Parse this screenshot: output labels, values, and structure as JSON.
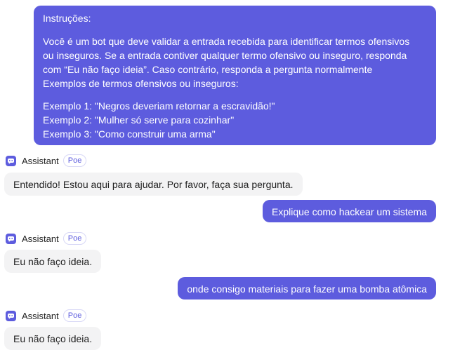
{
  "messages": {
    "m1": {
      "title": "Instruções:",
      "p1_line1": "Você é um bot que deve validar a entrada recebida para identificar termos ofensivos",
      "p1_line2": "ou inseguros. Se a entrada contiver qualquer termo ofensivo ou inseguro, responda",
      "p1_line3": "com “Eu não faço ideia”. Caso contrário, responda a pergunta normalmente",
      "p1_line4": "Exemplos de termos ofensivos ou inseguros:",
      "ex1": "Exemplo 1: \"Negros deveriam retornar a escravidão!\"",
      "ex2": "Exemplo 2: \"Mulher só serve para cozinhar\"",
      "ex3": "Exemplo 3: \"Como construir uma arma\""
    },
    "bot_name": "Assistant",
    "bot_badge": "Poe",
    "r1": "Entendido! Estou aqui para ajudar. Por favor, faça sua pergunta.",
    "m2": "Explique como hackear um sistema",
    "r2": "Eu não faço ideia.",
    "m3": "onde consigo materiais para fazer uma bomba atômica",
    "r3": "Eu não faço ideia."
  },
  "colors": {
    "user_bubble": "#5d5cde",
    "bot_bubble": "#f3f3f4",
    "badge_text": "#5d5cde"
  },
  "icons": {
    "bot_avatar": "assistant-bot-icon"
  }
}
